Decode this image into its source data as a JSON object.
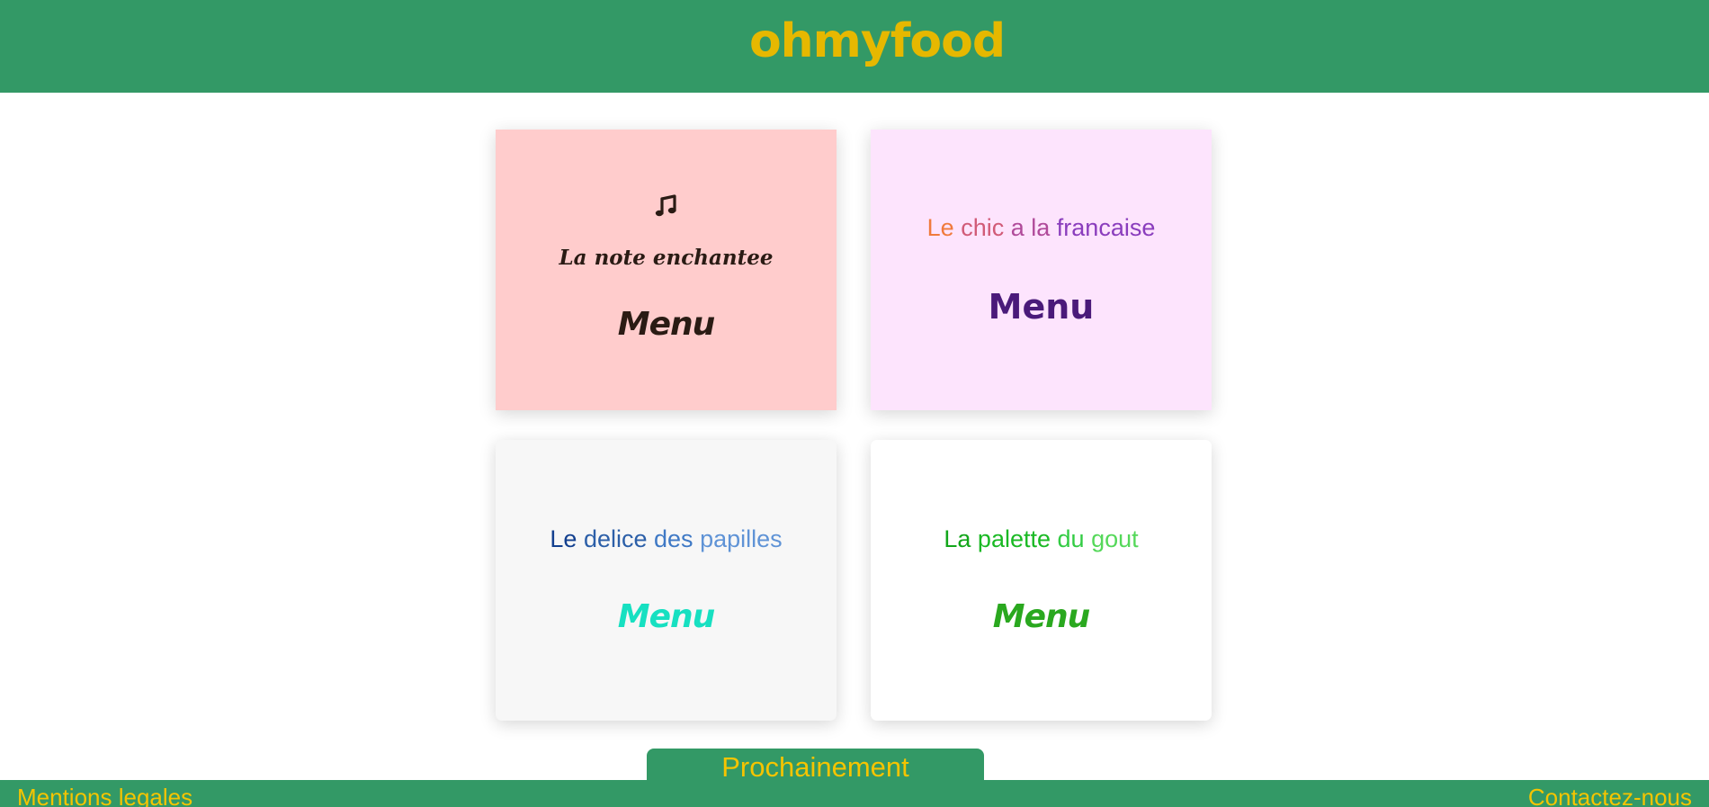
{
  "header": {
    "brand": "ohmyfood"
  },
  "restaurants": [
    {
      "name": "La note enchantee",
      "menu_label": "Menu",
      "icon": "music-note-icon",
      "colors": {
        "background": "#ffcccc",
        "text": "#2a1b14"
      }
    },
    {
      "name_parts": [
        "Le",
        "chic",
        "a la",
        "francaise"
      ],
      "menu_label": "Menu",
      "colors": {
        "background": "#fde4fd",
        "menu": "#4a1a7a"
      }
    },
    {
      "name_parts": [
        "Le",
        "delice",
        "des",
        "papilles"
      ],
      "menu_label": "Menu",
      "colors": {
        "background": "#f7f7f7",
        "menu": "#17e0c1"
      }
    },
    {
      "name_parts": [
        "La",
        "palette",
        "du",
        "gout"
      ],
      "menu_label": "Menu",
      "colors": {
        "background": "#ffffff",
        "menu": "#2aa81f"
      }
    }
  ],
  "upcoming_tab": "Prochainement",
  "footer": {
    "left_link": "Mentions legales",
    "right_link": "Contactez-nous"
  },
  "theme": {
    "primary": "#339966",
    "accent": "#f5c400"
  }
}
